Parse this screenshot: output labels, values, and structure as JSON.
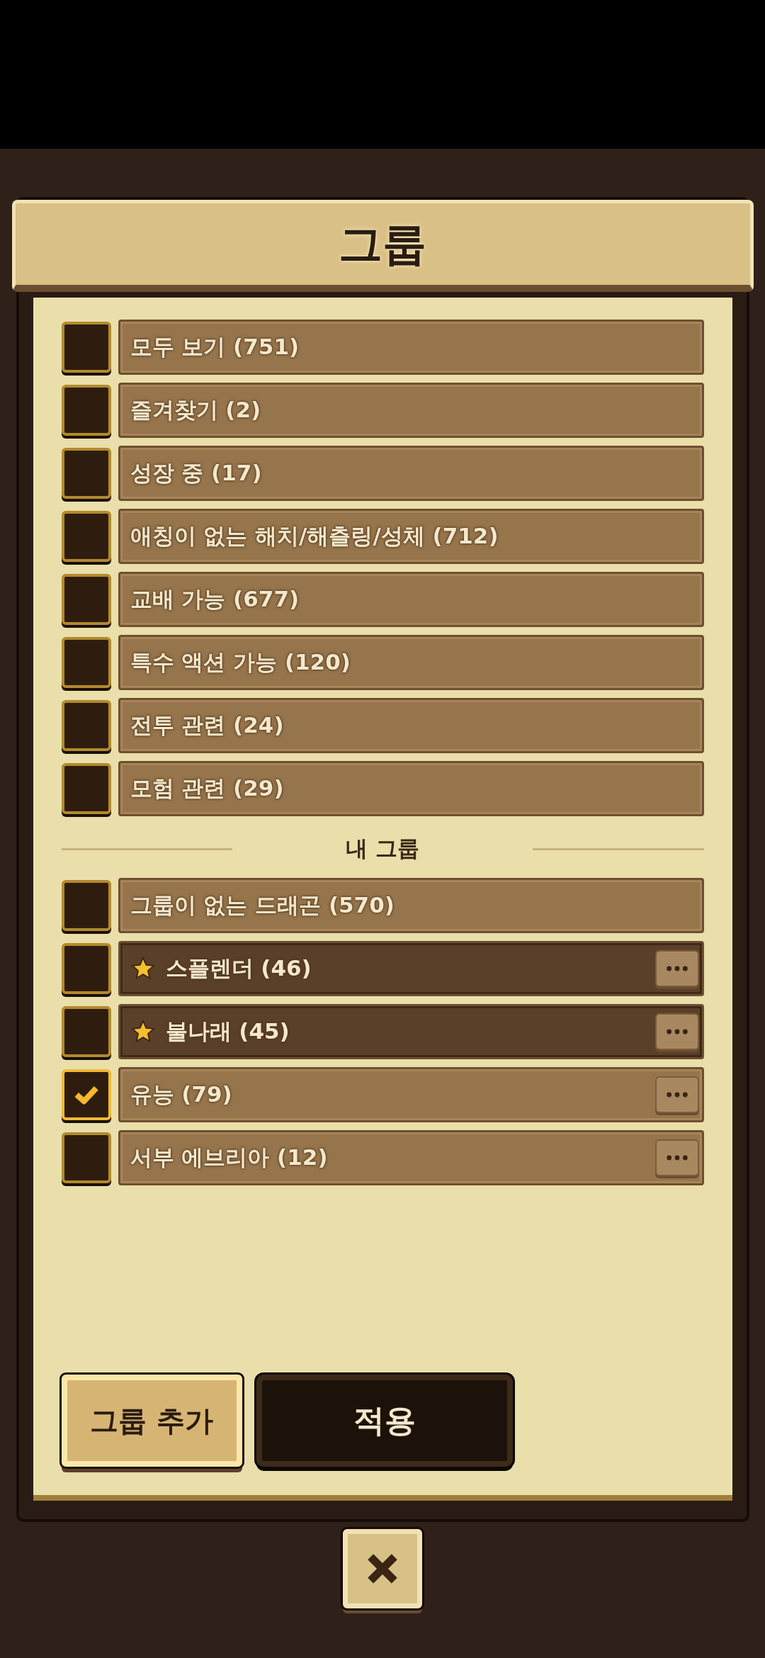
{
  "title": "그룹",
  "groups": [
    {
      "label": "모두 보기 (751)",
      "checked": false,
      "starred": false,
      "has_menu": false
    },
    {
      "label": "즐겨찾기 (2)",
      "checked": false,
      "starred": false,
      "has_menu": false
    },
    {
      "label": "성장 중 (17)",
      "checked": false,
      "starred": false,
      "has_menu": false
    },
    {
      "label": "애칭이 없는 해치/해츨링/성체 (712)",
      "checked": false,
      "starred": false,
      "has_menu": false
    },
    {
      "label": "교배 가능 (677)",
      "checked": false,
      "starred": false,
      "has_menu": false
    },
    {
      "label": "특수 액션 가능 (120)",
      "checked": false,
      "starred": false,
      "has_menu": false
    },
    {
      "label": "전투 관련 (24)",
      "checked": false,
      "starred": false,
      "has_menu": false
    },
    {
      "label": "모험 관련 (29)",
      "checked": false,
      "starred": false,
      "has_menu": false
    }
  ],
  "my_groups_heading": "내 그룹",
  "my_groups": [
    {
      "label": "그룹이 없는 드래곤 (570)",
      "checked": false,
      "starred": false,
      "has_menu": false
    },
    {
      "label": "스플렌더 (46)",
      "checked": false,
      "starred": true,
      "has_menu": true
    },
    {
      "label": "불나래 (45)",
      "checked": false,
      "starred": true,
      "has_menu": true
    },
    {
      "label": "유능 (79)",
      "checked": true,
      "starred": false,
      "has_menu": true
    },
    {
      "label": "서부 에브리아 (12)",
      "checked": false,
      "starred": false,
      "has_menu": true
    }
  ],
  "buttons": {
    "add": "그룹 추가",
    "apply": "적용"
  }
}
